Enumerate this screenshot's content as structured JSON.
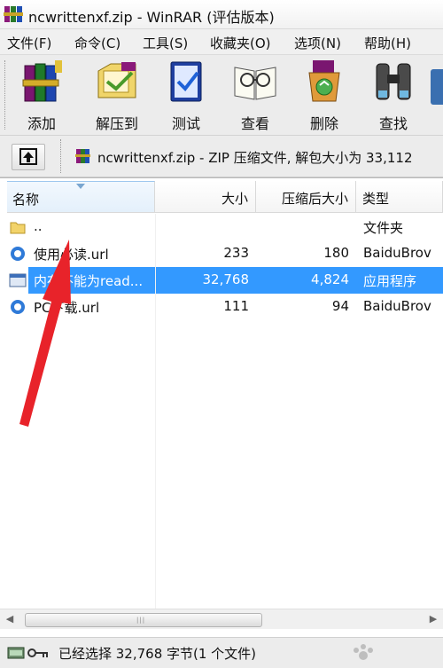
{
  "window": {
    "title": "ncwrittenxf.zip - WinRAR (评估版本)",
    "app_icon": "winrar-books-icon"
  },
  "menu": [
    "文件(F)",
    "命令(C)",
    "工具(S)",
    "收藏夹(O)",
    "选项(N)",
    "帮助(H)"
  ],
  "toolbar": {
    "buttons": [
      {
        "label": "添加",
        "icon": "add-archive-icon"
      },
      {
        "label": "解压到",
        "icon": "extract-to-icon"
      },
      {
        "label": "测试",
        "icon": "test-icon"
      },
      {
        "label": "查看",
        "icon": "view-icon"
      },
      {
        "label": "删除",
        "icon": "delete-icon"
      },
      {
        "label": "查找",
        "icon": "find-binoculars-icon"
      }
    ]
  },
  "address": {
    "up_icon": "up-one-level-icon",
    "path_text": "ncwrittenxf.zip - ZIP 压缩文件, 解包大小为 33,112"
  },
  "columns": {
    "name": "名称",
    "size": "大小",
    "packed": "压缩后大小",
    "type": "类型"
  },
  "files": [
    {
      "name": "..",
      "size": "",
      "packed": "",
      "type": "文件夹",
      "icon": "folder-icon",
      "selected": false
    },
    {
      "name": "使用必读.url",
      "size": "233",
      "packed": "180",
      "type": "BaiduBrov",
      "icon": "url-shortcut-icon",
      "selected": false
    },
    {
      "name": "内存不能为read...",
      "size": "32,768",
      "packed": "4,824",
      "type": "应用程序",
      "icon": "application-icon",
      "selected": true
    },
    {
      "name": "PC下载.url",
      "size": "111",
      "packed": "94",
      "type": "BaiduBrov",
      "icon": "url-shortcut-icon",
      "selected": false
    }
  ],
  "status": {
    "text": "已经选择 32,768 字节(1 个文件)"
  },
  "colors": {
    "selection": "#3399ff",
    "annotation_arrow": "#e8232a"
  }
}
